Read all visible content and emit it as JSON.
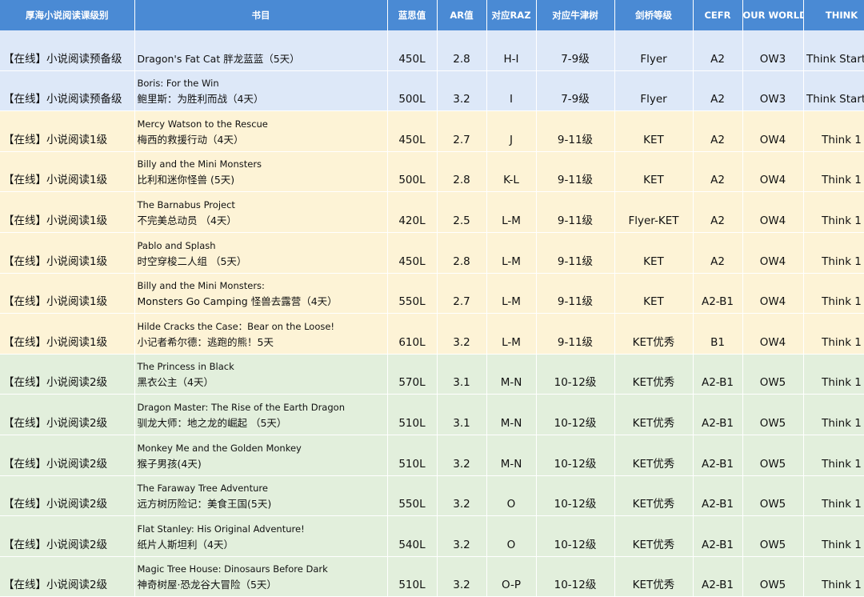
{
  "headers": [
    "厚海小说阅读课级别",
    "书目",
    "蓝思值",
    "AR值",
    "对应RAZ",
    "对应牛津树",
    "剑桥等级",
    "CEFR",
    "OUR WORLD",
    "THINK"
  ],
  "rows": [
    {
      "level": "【在线】小说阅读预备级",
      "en": "",
      "cn": "Dragon's Fat Cat 胖龙蓝蓝（5天）",
      "lexile": "450L",
      "ar": "2.8",
      "raz": "H-I",
      "oxford": "7-9级",
      "cambridge": "Flyer",
      "cefr": "A2",
      "ourworld": "OW3",
      "think": "Think Starter",
      "band": "pre"
    },
    {
      "level": "【在线】小说阅读预备级",
      "en": "Boris: For the Win",
      "cn": "鲍里斯：为胜利而战（4天）",
      "lexile": "500L",
      "ar": "3.2",
      "raz": "I",
      "oxford": "7-9级",
      "cambridge": "Flyer",
      "cefr": "A2",
      "ourworld": "OW3",
      "think": "Think Starter",
      "band": "pre"
    },
    {
      "level": "【在线】小说阅读1级",
      "en": "Mercy Watson to the Rescue",
      "cn": "梅西的救援行动（4天）",
      "lexile": "450L",
      "ar": "2.7",
      "raz": "J",
      "oxford": "9-11级",
      "cambridge": "KET",
      "cefr": "A2",
      "ourworld": "OW4",
      "think": "Think 1",
      "band": "l1"
    },
    {
      "level": "【在线】小说阅读1级",
      "en": "Billy and the Mini Monsters",
      "cn": "比利和迷你怪兽 (5天)",
      "lexile": "500L",
      "ar": "2.8",
      "raz": "K-L",
      "oxford": "9-11级",
      "cambridge": "KET",
      "cefr": "A2",
      "ourworld": "OW4",
      "think": "Think 1",
      "band": "l1"
    },
    {
      "level": "【在线】小说阅读1级",
      "en": "The Barnabus Project",
      "cn": "不完美总动员 （4天）",
      "lexile": "420L",
      "ar": "2.5",
      "raz": "L-M",
      "oxford": "9-11级",
      "cambridge": "Flyer-KET",
      "cefr": "A2",
      "ourworld": "OW4",
      "think": "Think 1",
      "band": "l1"
    },
    {
      "level": "【在线】小说阅读1级",
      "en": "Pablo and Splash",
      "cn": "时空穿梭二人组 （5天）",
      "lexile": "450L",
      "ar": "2.8",
      "raz": "L-M",
      "oxford": "9-11级",
      "cambridge": "KET",
      "cefr": "A2",
      "ourworld": "OW4",
      "think": "Think 1",
      "band": "l1"
    },
    {
      "level": "【在线】小说阅读1级",
      "en": "Billy and the Mini Monsters:",
      "cn": "Monsters Go Camping 怪兽去露营（4天）",
      "lexile": "550L",
      "ar": "2.7",
      "raz": "L-M",
      "oxford": "9-11级",
      "cambridge": "KET",
      "cefr": "A2-B1",
      "ourworld": "OW4",
      "think": "Think 1",
      "band": "l1"
    },
    {
      "level": "【在线】小说阅读1级",
      "en": "Hilde Cracks the Case：Bear on the Loose!",
      "cn": "小记者希尔德：逃跑的熊！5天",
      "lexile": "610L",
      "ar": "3.2",
      "raz": "L-M",
      "oxford": "9-11级",
      "cambridge": "KET优秀",
      "cefr": "B1",
      "ourworld": "OW4",
      "think": "Think 1",
      "band": "l1"
    },
    {
      "level": "【在线】小说阅读2级",
      "en": "The Princess in Black",
      "cn": "黑衣公主（4天）",
      "lexile": "570L",
      "ar": "3.1",
      "raz": "M-N",
      "oxford": "10-12级",
      "cambridge": "KET优秀",
      "cefr": "A2-B1",
      "ourworld": "OW5",
      "think": "Think 1",
      "band": "l2"
    },
    {
      "level": "【在线】小说阅读2级",
      "en": "Dragon Master: The Rise of the Earth Dragon",
      "cn": "驯龙大师：地之龙的崛起 （5天）",
      "lexile": "510L",
      "ar": "3.1",
      "raz": "M-N",
      "oxford": "10-12级",
      "cambridge": "KET优秀",
      "cefr": "A2-B1",
      "ourworld": "OW5",
      "think": "Think 1",
      "band": "l2"
    },
    {
      "level": "【在线】小说阅读2级",
      "en": "Monkey Me and the Golden Monkey",
      "cn": "猴子男孩(4天)",
      "lexile": "510L",
      "ar": "3.2",
      "raz": "M-N",
      "oxford": "10-12级",
      "cambridge": "KET优秀",
      "cefr": "A2-B1",
      "ourworld": "OW5",
      "think": "Think 1",
      "band": "l2"
    },
    {
      "level": "【在线】小说阅读2级",
      "en": "The Faraway Tree Adventure",
      "cn": "远方树历险记：美食王国(5天)",
      "lexile": "550L",
      "ar": "3.2",
      "raz": "O",
      "oxford": "10-12级",
      "cambridge": "KET优秀",
      "cefr": "A2-B1",
      "ourworld": "OW5",
      "think": "Think 1",
      "band": "l2"
    },
    {
      "level": "【在线】小说阅读2级",
      "en": "Flat Stanley: His Original Adventure!",
      "cn": "纸片人斯坦利（4天）",
      "lexile": "540L",
      "ar": "3.2",
      "raz": "O",
      "oxford": "10-12级",
      "cambridge": "KET优秀",
      "cefr": "A2-B1",
      "ourworld": "OW5",
      "think": "Think 1",
      "band": "l2"
    },
    {
      "level": "【在线】小说阅读2级",
      "en": "Magic Tree House: Dinosaurs Before Dark",
      "cn": "神奇树屋·恐龙谷大冒险（5天）",
      "lexile": "510L",
      "ar": "3.2",
      "raz": "O-P",
      "oxford": "10-12级",
      "cambridge": "KET优秀",
      "cefr": "A2-B1",
      "ourworld": "OW5",
      "think": "Think 1",
      "band": "l2"
    }
  ]
}
